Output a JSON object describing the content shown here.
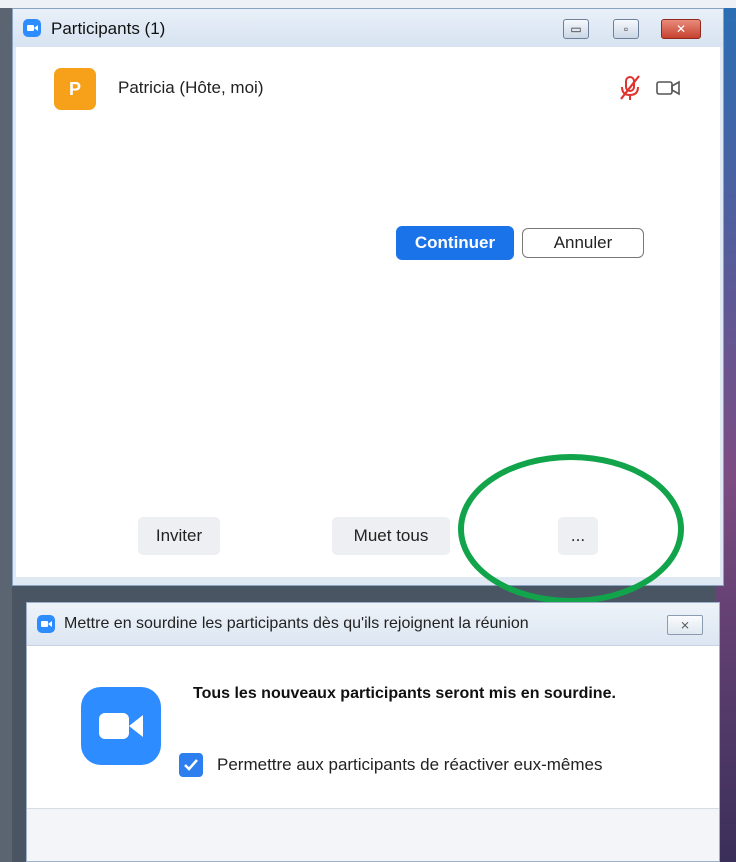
{
  "participants_window": {
    "title": "Participants (1)",
    "window_controls": {
      "minimize": "▭",
      "maximize": "▫",
      "close": "✕"
    },
    "participants": [
      {
        "avatar_letter": "P",
        "name": "Patricia (Hôte, moi)",
        "mic": "muted-mic-icon",
        "camera": "video-camera-icon"
      }
    ],
    "buttons": {
      "invite": "Inviter",
      "mute_all": "Muet tous",
      "more": "..."
    }
  },
  "mute_dialog": {
    "title": "Mettre en sourdine les participants dès qu'ils rejoignent la réunion",
    "close": "⨯",
    "message": "Tous les nouveaux participants seront mis en sourdine.",
    "checkbox": {
      "label": "Permettre aux participants de réactiver eux-mêmes",
      "checked": true
    },
    "buttons": {
      "continue": "Continuer",
      "cancel": "Annuler"
    }
  },
  "colors": {
    "zoom_blue": "#2d8cff",
    "avatar": "#f7a11a",
    "muted_red": "#e0322f",
    "highlight_oval": "#11a44a",
    "primary_button": "#1a73e8"
  }
}
